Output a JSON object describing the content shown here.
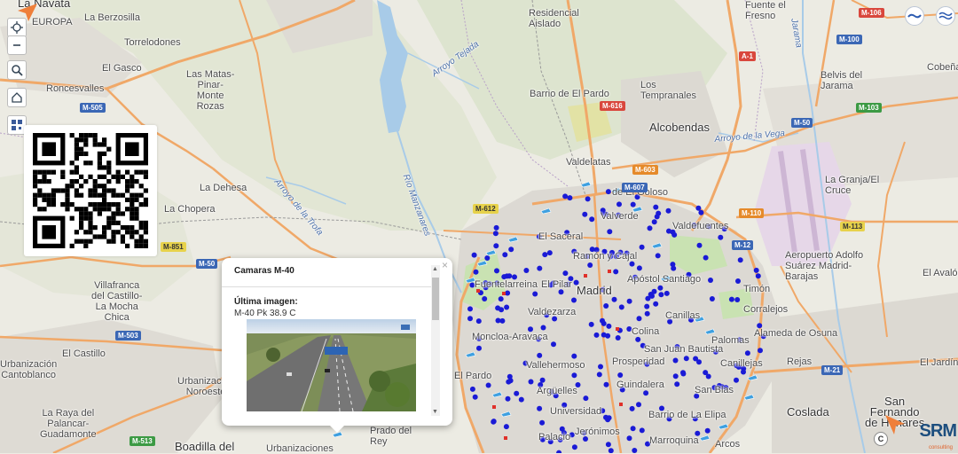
{
  "map": {
    "places": [
      {
        "id": "la-navata",
        "name": "La Navata",
        "cls": "city"
      },
      {
        "id": "la-berzosilla",
        "name": "La Berzosilla",
        "cls": ""
      },
      {
        "id": "torrelodones",
        "name": "Torrelodones",
        "cls": ""
      },
      {
        "id": "el-gasco",
        "name": "El Gasco",
        "cls": ""
      },
      {
        "id": "las-matas",
        "name": "Las Matas-\nPinar-\nMonte\nRozas",
        "cls": ""
      },
      {
        "id": "roncesvalles",
        "name": "Roncesvalles",
        "cls": ""
      },
      {
        "id": "la-dehesa",
        "name": "La Dehesa",
        "cls": ""
      },
      {
        "id": "la-chopera",
        "name": "La Chopera",
        "cls": ""
      },
      {
        "id": "villafranca",
        "name": "Villafranca\ndel Castillo-\nLa Mocha\nChica",
        "cls": ""
      },
      {
        "id": "el-castillo",
        "name": "El Castillo",
        "cls": ""
      },
      {
        "id": "urb-cantoblanco",
        "name": "Urbanización\nCantoblanco",
        "cls": ""
      },
      {
        "id": "urb-noroeste",
        "name": "Urbanización\nNoroeste",
        "cls": ""
      },
      {
        "id": "la-raya",
        "name": "La Raya del\nPalancar-\nGuadamonte",
        "cls": ""
      },
      {
        "id": "boadilla",
        "name": "Boadilla del",
        "cls": "city"
      },
      {
        "id": "urbanizaciones",
        "name": "Urbanizaciones",
        "cls": ""
      },
      {
        "id": "prado-del-rey",
        "name": "Prado del\nRey",
        "cls": ""
      },
      {
        "id": "residencial-aislado",
        "name": "Residencial\nAislado",
        "cls": ""
      },
      {
        "id": "barrio-el-pardo",
        "name": "Barrio de El Pardo",
        "cls": ""
      },
      {
        "id": "los-tempranales",
        "name": "Los\nTempranales",
        "cls": ""
      },
      {
        "id": "alcobendas",
        "name": "Alcobendas",
        "cls": "city"
      },
      {
        "id": "valdelatas",
        "name": "Valdelatas",
        "cls": ""
      },
      {
        "id": "el-goloso",
        "name": "de El Goloso",
        "cls": ""
      },
      {
        "id": "valverde",
        "name": "Valverde",
        "cls": ""
      },
      {
        "id": "valdefuentes",
        "name": "Valdefuentes",
        "cls": ""
      },
      {
        "id": "el-saceral",
        "name": "El Saceral",
        "cls": ""
      },
      {
        "id": "fuentelarreina",
        "name": "Fuentelarreina",
        "cls": ""
      },
      {
        "id": "el-pilar",
        "name": "El Pilar",
        "cls": ""
      },
      {
        "id": "valdezarza",
        "name": "Valdezarza",
        "cls": ""
      },
      {
        "id": "moncloa",
        "name": "Moncloa-Aravaca",
        "cls": ""
      },
      {
        "id": "madrid",
        "name": "Madrid",
        "cls": "city"
      },
      {
        "id": "ramon-cajal",
        "name": "Ramón y Cajal",
        "cls": ""
      },
      {
        "id": "apostol-santiago",
        "name": "Apóstol Santiago",
        "cls": ""
      },
      {
        "id": "canillas",
        "name": "Canillas",
        "cls": ""
      },
      {
        "id": "colina",
        "name": "Colina",
        "cls": ""
      },
      {
        "id": "san-juan-bautista",
        "name": "San Juan Bautista",
        "cls": ""
      },
      {
        "id": "vallehermoso",
        "name": "Vallehermoso",
        "cls": ""
      },
      {
        "id": "prosperidad",
        "name": "Prosperidad",
        "cls": ""
      },
      {
        "id": "el-pardo",
        "name": "El Pardo",
        "cls": ""
      },
      {
        "id": "arguelles",
        "name": "Argüelles",
        "cls": ""
      },
      {
        "id": "guindalera",
        "name": "Guindalera",
        "cls": ""
      },
      {
        "id": "san-blas",
        "name": "San Blas",
        "cls": ""
      },
      {
        "id": "universidad",
        "name": "Universidad",
        "cls": ""
      },
      {
        "id": "barrio-la-elipa",
        "name": "Barrio de La Elipa",
        "cls": ""
      },
      {
        "id": "palacio",
        "name": "Palacio",
        "cls": ""
      },
      {
        "id": "jeronimos",
        "name": "Jerónimos",
        "cls": ""
      },
      {
        "id": "marroquina",
        "name": "Marroquina",
        "cls": ""
      },
      {
        "id": "arcos",
        "name": "Arcos",
        "cls": ""
      },
      {
        "id": "canillejas",
        "name": "Canillejas",
        "cls": ""
      },
      {
        "id": "palomas",
        "name": "Palomas",
        "cls": ""
      },
      {
        "id": "timon",
        "name": "Timón",
        "cls": ""
      },
      {
        "id": "corralejos",
        "name": "Corralejos",
        "cls": ""
      },
      {
        "id": "alameda-osuna",
        "name": "Alameda de Osuna",
        "cls": ""
      },
      {
        "id": "rejas",
        "name": "Rejas",
        "cls": ""
      },
      {
        "id": "coslada",
        "name": "Coslada",
        "cls": "city"
      },
      {
        "id": "san-fernando",
        "name": "San\nFernando\nde Henares",
        "cls": "city"
      },
      {
        "id": "el-jardin",
        "name": "El Jardín",
        "cls": ""
      },
      {
        "id": "aeropuerto",
        "name": "Aeropuerto Adolfo\nSuárez Madrid-\nBarajas",
        "cls": ""
      },
      {
        "id": "el-avalon",
        "name": "El Avalón",
        "cls": ""
      },
      {
        "id": "la-granja",
        "name": "La Granja/El\nCruce",
        "cls": ""
      },
      {
        "id": "belvis",
        "name": "Belvis del\nJarama",
        "cls": ""
      },
      {
        "id": "cobena",
        "name": "Cobeña",
        "cls": ""
      },
      {
        "id": "fuente-fresno",
        "name": "Fuente el\nFresno",
        "cls": ""
      },
      {
        "id": "europa",
        "name": "EUROPA",
        "cls": ""
      }
    ],
    "rivers": [
      {
        "id": "arroyo-tejada",
        "name": "Arroyo Tejada"
      },
      {
        "id": "arroyo-vega",
        "name": "Arroyo de la Vega"
      },
      {
        "id": "arroyo-trofa",
        "name": "Arroyo de la Trofa"
      },
      {
        "id": "rio-manzanares",
        "name": "Río Manzanares"
      },
      {
        "id": "jarama",
        "name": "Jarama"
      }
    ],
    "roads": [
      {
        "id": "m505",
        "name": "M-505",
        "color": "blue"
      },
      {
        "id": "m851",
        "name": "M-851",
        "color": "yellow"
      },
      {
        "id": "m50w",
        "name": "M-50",
        "color": "blue"
      },
      {
        "id": "m503",
        "name": "M-503",
        "color": "blue"
      },
      {
        "id": "m513",
        "name": "M-513",
        "color": "green"
      },
      {
        "id": "m612",
        "name": "M-612",
        "color": "yellow"
      },
      {
        "id": "m616",
        "name": "M-616",
        "color": "red"
      },
      {
        "id": "m603",
        "name": "M-603",
        "color": "orange"
      },
      {
        "id": "m607",
        "name": "M-607",
        "color": "blue"
      },
      {
        "id": "m110",
        "name": "M-110",
        "color": "orange"
      },
      {
        "id": "m12",
        "name": "M-12",
        "color": "blue"
      },
      {
        "id": "m113",
        "name": "M-113",
        "color": "yellow"
      },
      {
        "id": "m50e",
        "name": "M-50",
        "color": "blue"
      },
      {
        "id": "m103",
        "name": "M-103",
        "color": "green"
      },
      {
        "id": "m100",
        "name": "M-100",
        "color": "blue"
      },
      {
        "id": "m106",
        "name": "M-106",
        "color": "red"
      },
      {
        "id": "m21",
        "name": "M-21",
        "color": "blue"
      },
      {
        "id": "a1",
        "name": "A-1",
        "color": "red"
      }
    ]
  },
  "popup": {
    "title": "Camaras M-40",
    "close": "×",
    "subtitle": "Última imagen:",
    "camera": "M-40 Pk 38.9 C"
  },
  "logo": {
    "brand": "SRM",
    "tagline": "consulting"
  },
  "copyright": "C",
  "colors": {
    "dot": "#1a1ad6",
    "water": "#a8cbe8",
    "urban": "#d8d6d2",
    "green": "#c9e2b2"
  }
}
